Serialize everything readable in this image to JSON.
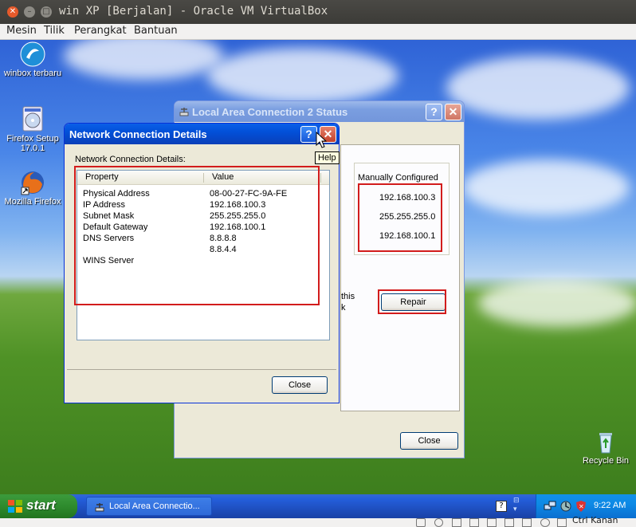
{
  "host": {
    "title": "win XP [Berjalan] - Oracle VM VirtualBox",
    "menu": [
      "Mesin",
      "Tilik",
      "Perangkat",
      "Bantuan"
    ],
    "status_label": "Ctrl Kanan"
  },
  "desktop_icons": [
    {
      "label": "winbox terbaru",
      "icon": "winbox-icon"
    },
    {
      "label": "Firefox Setup 17.0.1",
      "icon": "installer-cd-icon"
    },
    {
      "label": "Mozilla Firefox",
      "icon": "firefox-icon"
    },
    {
      "label": "Recycle Bin",
      "icon": "recycle-bin-icon"
    }
  ],
  "status_window": {
    "title": "Local Area Connection 2 Status",
    "column_header": "Manually Configured",
    "values": [
      "192.168.100.3",
      "255.255.255.0",
      "192.168.100.1"
    ],
    "partial_text_1": "this",
    "partial_text_2": "k",
    "repair_label": "Repair",
    "close_label": "Close"
  },
  "details_window": {
    "title": "Network Connection Details",
    "caption": "Network Connection Details:",
    "tooltip": "Help",
    "headers": {
      "property": "Property",
      "value": "Value"
    },
    "rows": [
      {
        "property": "Physical Address",
        "value": "08-00-27-FC-9A-FE"
      },
      {
        "property": "IP Address",
        "value": "192.168.100.3"
      },
      {
        "property": "Subnet Mask",
        "value": "255.255.255.0"
      },
      {
        "property": "Default Gateway",
        "value": "192.168.100.1"
      },
      {
        "property": "DNS Servers",
        "value": "8.8.8.8"
      },
      {
        "property": "",
        "value": "8.8.4.4"
      },
      {
        "property": "WINS Server",
        "value": ""
      }
    ],
    "close_label": "Close"
  },
  "taskbar": {
    "start_label": "start",
    "task_label": "Local Area Connectio...",
    "clock": "9:22 AM"
  },
  "colors": {
    "highlight_red": "#d21c1c",
    "xp_title_blue": "#0250d8",
    "start_green": "#2e8b2e"
  }
}
